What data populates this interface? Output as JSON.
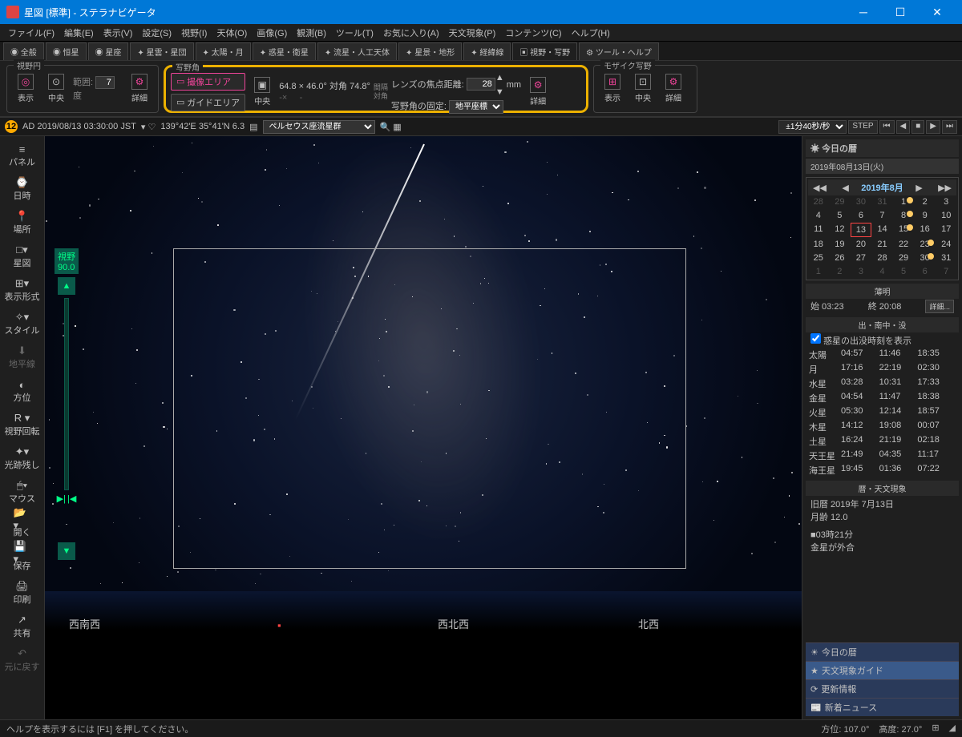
{
  "title": "星図 [標準] - ステラナビゲータ",
  "menu": [
    "ファイル(F)",
    "編集(E)",
    "表示(V)",
    "設定(S)",
    "視野(I)",
    "天体(O)",
    "画像(G)",
    "観測(B)",
    "ツール(T)",
    "お気に入り(A)",
    "天文現象(P)",
    "コンテンツ(C)",
    "ヘルプ(H)"
  ],
  "tabs": [
    "全般",
    "恒星",
    "星座",
    "星雲・星団",
    "太陽・月",
    "惑星・衛星",
    "流星・人工天体",
    "星景・地形",
    "経緯線",
    "視野・写野",
    "ツール・ヘルプ"
  ],
  "activeTab": 9,
  "toolbar": {
    "fovCircle": {
      "label": "視野円",
      "show": "表示",
      "center": "中央",
      "range": "範囲:",
      "rangeVal": "7",
      "unit": "度",
      "detail": "詳細"
    },
    "fovAngle": {
      "label": "写野角",
      "captureArea": "撮像エリア",
      "guideArea": "ガイドエリア",
      "center": "中央",
      "size1": "64.8 ×",
      "size2": "46.0°",
      "diag": "対角",
      "diagVal": "74.8°",
      "gap": "間隔\n対角",
      "gap1": "-×",
      "gap2": "-",
      "focal": "レンズの焦点距離:",
      "focalVal": "28",
      "mm": "mm",
      "fix": "写野角の固定:",
      "fixVal": "地平座標",
      "detail": "詳細"
    },
    "mosaic": {
      "label": "モザイク写野",
      "show": "表示",
      "center": "中央",
      "detail": "詳細"
    }
  },
  "status": {
    "badge": "12",
    "date": "AD  2019/08/13 03:30:00 JST",
    "coord": "139°42'E 35°41'N   6.3",
    "target": "ペルセウス座流星群",
    "speed": "±1分40秒/秒",
    "step": "STEP"
  },
  "sidebar": [
    {
      "i": "≡",
      "t": "パネル"
    },
    {
      "i": "⌚",
      "t": "日時"
    },
    {
      "i": "📍",
      "t": "場所"
    },
    {
      "i": "□▾",
      "t": "星図"
    },
    {
      "i": "⊞▾",
      "t": "表示形式"
    },
    {
      "i": "✧▾",
      "t": "スタイル"
    },
    {
      "i": "⬇",
      "t": "地平線",
      "dim": true
    },
    {
      "i": "◐",
      "t": "方位"
    },
    {
      "i": "R ▾",
      "t": "視野回転"
    },
    {
      "i": "✦▾",
      "t": "光跡残し"
    },
    {
      "i": "🖱▾",
      "t": "マウス"
    },
    {
      "i": "📂▾",
      "t": "開く"
    },
    {
      "i": "💾▾",
      "t": "保存"
    },
    {
      "i": "🖨",
      "t": "印刷"
    },
    {
      "i": "↗",
      "t": "共有"
    },
    {
      "i": "↶",
      "t": "元に戻す",
      "dim": true
    }
  ],
  "fov": {
    "label": "視野",
    "value": "90.0"
  },
  "directions": {
    "wsw": "西南西",
    "wnw": "西北西",
    "nw": "北西"
  },
  "rpanel": {
    "title": "今日の暦",
    "fullDate": "2019年08月13日(火)",
    "cal": {
      "month": "2019年8月",
      "prev": [
        28,
        29,
        30,
        31
      ],
      "days": 31,
      "today": 13,
      "moons": [
        1,
        8,
        15,
        23,
        30
      ]
    },
    "twilight": {
      "label": "薄明",
      "start": "始 03:23",
      "end": "終 20:08",
      "detail": "詳細..."
    },
    "riseSet": {
      "label": "出・南中・没",
      "cb": "惑星の出没時刻を表示"
    },
    "planets": [
      {
        "n": "太陽",
        "r": "04:57",
        "t": "11:46",
        "s": "18:35"
      },
      {
        "n": "月",
        "r": "17:16",
        "t": "22:19",
        "s": "02:30"
      },
      {
        "n": "水星",
        "r": "03:28",
        "t": "10:31",
        "s": "17:33"
      },
      {
        "n": "金星",
        "r": "04:54",
        "t": "11:47",
        "s": "18:38"
      },
      {
        "n": "火星",
        "r": "05:30",
        "t": "12:14",
        "s": "18:57"
      },
      {
        "n": "木星",
        "r": "14:12",
        "t": "19:08",
        "s": "00:07"
      },
      {
        "n": "土星",
        "r": "16:24",
        "t": "21:19",
        "s": "02:18"
      },
      {
        "n": "天王星",
        "r": "21:49",
        "t": "04:35",
        "s": "11:17"
      },
      {
        "n": "海王星",
        "r": "19:45",
        "t": "01:36",
        "s": "07:22"
      }
    ],
    "events": {
      "label": "暦・天文現象",
      "line1": "旧暦 2019年 7月13日",
      "line2": "月齢 12.0",
      "ev1": "■03時21分",
      "ev2": "  金星が外合"
    },
    "bottom": [
      {
        "i": "☀",
        "t": "今日の暦"
      },
      {
        "i": "★",
        "t": "天文現象ガイド",
        "a": true
      },
      {
        "i": "⟳",
        "t": "更新情報"
      },
      {
        "i": "📰",
        "t": "新着ニュース"
      }
    ]
  },
  "footer": {
    "help": "ヘルプを表示するには [F1] を押してください。",
    "az": "方位: 107.0°",
    "alt": "高度: 27.0°"
  }
}
